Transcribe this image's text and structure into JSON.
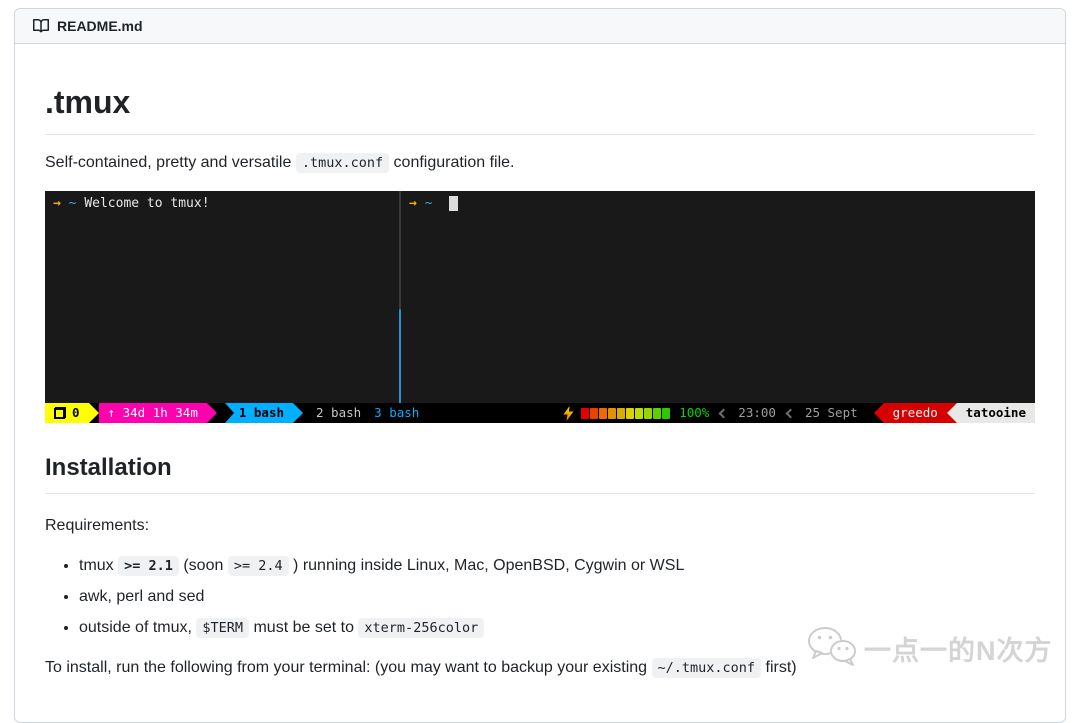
{
  "colors": {
    "yellow": "#ffff00",
    "pink": "#ff00af",
    "blue": "#00afff",
    "red": "#d70000",
    "green": "#00d700",
    "chip_white": "#e8e8e6",
    "terminal_bg": "#191919",
    "statusbar_bg": "#000000",
    "prompt_arrow": "#ffaf00",
    "prompt_tilde": "#39a7dc",
    "divider_gray": "#3a3a3a",
    "divider_blue": "#2492d6",
    "window_inactive": "#c6c6c6",
    "text_muted": "#9e9e9e"
  },
  "file_header": {
    "filename": "README.md",
    "icon": "book-icon"
  },
  "readme": {
    "title": ".tmux",
    "intro": {
      "pre": "Self-contained, pretty and versatile ",
      "code": ".tmux.conf",
      "post": " configuration file."
    },
    "installation_heading": "Installation",
    "requirements_label": "Requirements:",
    "bullet1": {
      "pre": "tmux ",
      "code1": ">= 2.1",
      "mid": " (soon ",
      "code2": ">= 2.4",
      "post": " ) running inside Linux, Mac, OpenBSD, Cygwin or WSL"
    },
    "bullet2": "awk, perl and sed",
    "bullet3": {
      "pre": "outside of tmux, ",
      "code1": "$TERM",
      "mid": " must be set to ",
      "code2": "xterm-256color"
    },
    "install_note": {
      "pre": "To install, run the following from your terminal: (you may want to backup your existing ",
      "code": "~/.tmux.conf",
      "post": " first)"
    }
  },
  "terminal": {
    "left_pane": {
      "arrow": "→",
      "path": "~",
      "text": "Welcome to tmux!"
    },
    "right_pane": {
      "arrow": "→",
      "path": "~"
    },
    "status_bar": {
      "session_name": "0",
      "uptime": "↑ 34d 1h 34m",
      "windows": [
        {
          "label": "1 bash",
          "active": true
        },
        {
          "label": "2 bash",
          "active": false
        },
        {
          "label": "3 bash",
          "active": false
        }
      ],
      "battery": {
        "percent": "100%",
        "colors": [
          "#e80000",
          "#ea4300",
          "#ec6c00",
          "#e49000",
          "#d8ae00",
          "#dcd200",
          "#bfdc00",
          "#93d600",
          "#5ecf00",
          "#2ec800"
        ]
      },
      "time": "23:00",
      "date": "25 Sept",
      "user": "greedo",
      "host": "tatooine"
    }
  },
  "watermark": {
    "text": "一点一的N次方",
    "icon": "wechat-icon"
  }
}
